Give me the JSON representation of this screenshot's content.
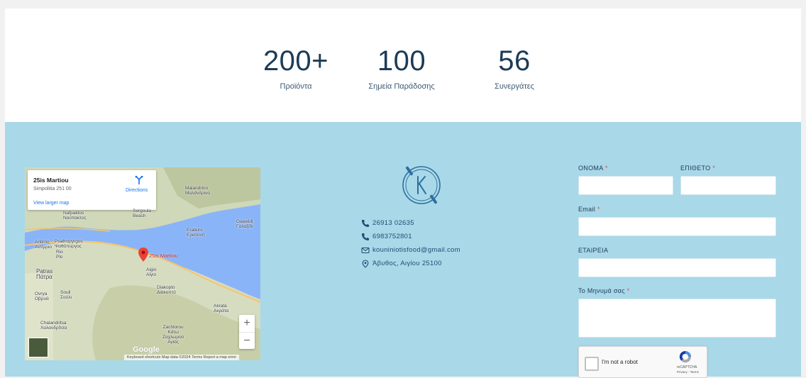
{
  "stats": [
    {
      "value": "200+",
      "label": "Προϊόντα"
    },
    {
      "value": "100",
      "label": "Σημεία Παράδοσης"
    },
    {
      "value": "56",
      "label": "Συνεργάτες"
    }
  ],
  "map": {
    "place_name": "25is Martiou",
    "address": "Simpolitia 251 00",
    "directions": "Directions",
    "view_larger": "View larger map",
    "pin_label": "25is Martiou",
    "places": [
      {
        "name": "Malandrino\nΜαλάνδρινο"
      },
      {
        "name": "Nafpaktos\nΝαύπακτος"
      },
      {
        "name": "Sergoula\nBeach"
      },
      {
        "name": "Erateini\nΕρατεινή"
      },
      {
        "name": "Galaxidi\nΓαλαξίδι"
      },
      {
        "name": "Antirrio\nΑντίρριο"
      },
      {
        "name": "Psathopyrgos\nΨαθόπυργος"
      },
      {
        "name": "Rio\nΡίο"
      },
      {
        "name": "Patras\nΠάτρα"
      },
      {
        "name": "Aigio\nΑίγιο"
      },
      {
        "name": "Ovrya\nΟβρυά"
      },
      {
        "name": "Souli\nΣούλι"
      },
      {
        "name": "Diakopto\nΔιακοπτό"
      },
      {
        "name": "Akrata\nΑκράτα"
      },
      {
        "name": "Chalandritsa\nΧαλανδρίτσα"
      },
      {
        "name": "Zachlorou\nΚάτω\nΖαχλωρού\nΑγιάς"
      }
    ],
    "zoom_in": "+",
    "zoom_out": "−",
    "google": "Google",
    "attribution": "Keyboard shortcuts   Map data ©2024   Terms   Report a map error"
  },
  "contact": {
    "phone1": "26913 02635",
    "phone2": "6983752801",
    "email": "kouniniotisfood@gmail.com",
    "address": "Άβυθος, Αιγίου 25100"
  },
  "form": {
    "first_name_label": "ΟΝΟΜΑ",
    "last_name_label": "ΕΠΙΘΕΤΟ",
    "email_label": "Email",
    "company_label": "ΕΤΑΙΡΕΙΑ",
    "message_label": "Το Μηνυμά σας",
    "required_mark": "*",
    "first_name_value": "",
    "last_name_value": "",
    "email_value": "",
    "company_value": "",
    "message_value": ""
  },
  "recaptcha": {
    "label": "I'm not a robot",
    "brand": "reCAPTCHA",
    "links": "Privacy - Terms"
  },
  "colors": {
    "footer_bg": "#a9d8e8",
    "text_dark": "#1c3b57",
    "required": "#e24b4b"
  }
}
